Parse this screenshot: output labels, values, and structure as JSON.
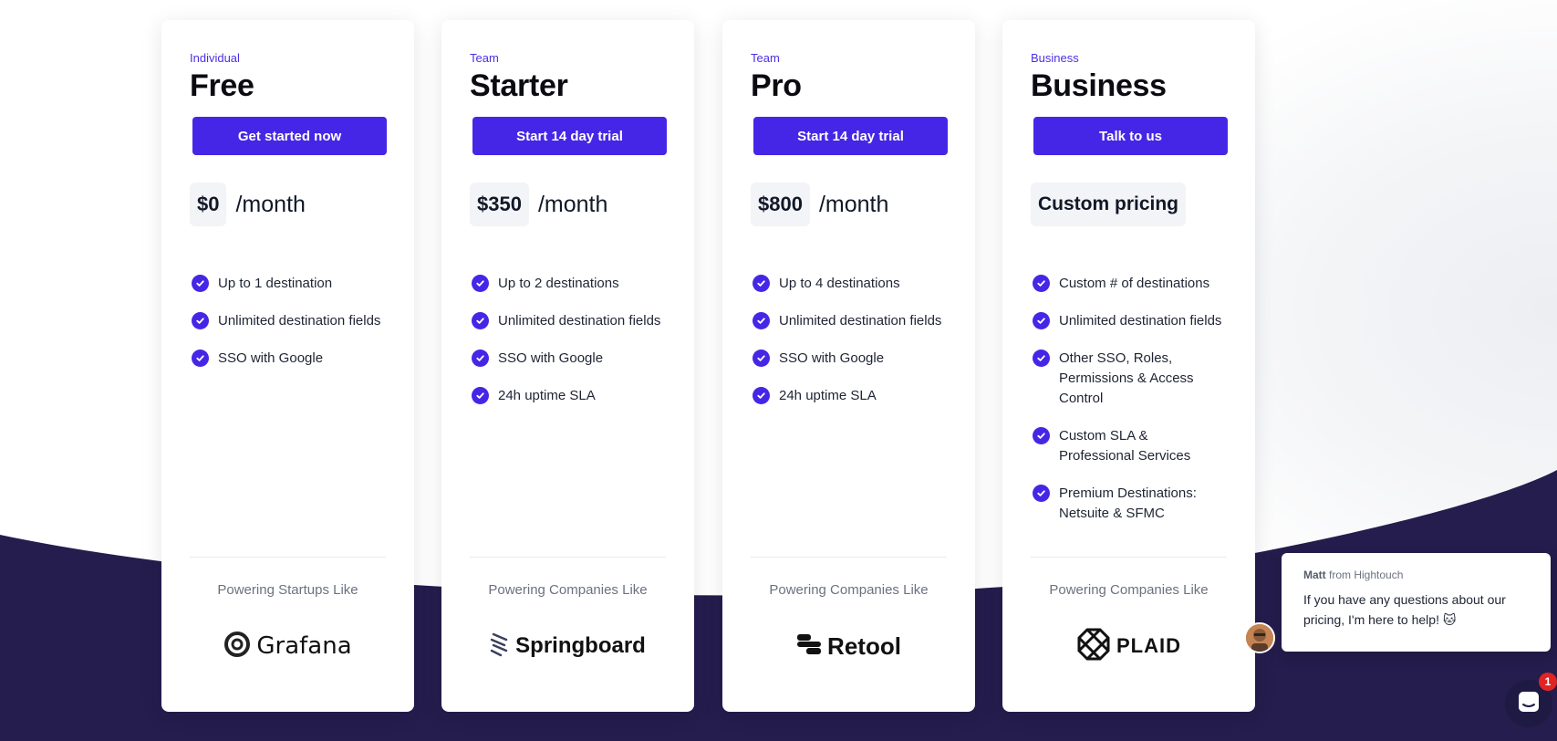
{
  "colors": {
    "accent": "#4626e6",
    "tier_label": "#4f2ee6",
    "dark_navy": "#241d4d",
    "badge_red": "#e02424"
  },
  "plans": [
    {
      "tier": "Individual",
      "name": "Free",
      "cta": "Get started now",
      "price": "$0",
      "period": "/month",
      "features": [
        "Up to 1 destination",
        "Unlimited destination fields",
        "SSO with Google"
      ],
      "powering": "Powering Startups Like",
      "logo": {
        "icon": "grafana-logo-icon",
        "text": "Grafana"
      }
    },
    {
      "tier": "Team",
      "name": "Starter",
      "cta": "Start 14 day trial",
      "price": "$350",
      "period": "/month",
      "features": [
        "Up to 2 destinations",
        "Unlimited destination fields",
        "SSO with Google",
        "24h uptime SLA"
      ],
      "powering": "Powering Companies Like",
      "logo": {
        "icon": "springboard-logo-icon",
        "text": "Springboard"
      }
    },
    {
      "tier": "Team",
      "name": "Pro",
      "cta": "Start 14 day trial",
      "price": "$800",
      "period": "/month",
      "features": [
        "Up to 4 destinations",
        "Unlimited destination fields",
        "SSO with Google",
        "24h uptime SLA"
      ],
      "powering": "Powering Companies Like",
      "logo": {
        "icon": "retool-logo-icon",
        "text": "Retool"
      }
    },
    {
      "tier": "Business",
      "name": "Business",
      "cta": "Talk to us",
      "price": "Custom pricing",
      "period": "",
      "features": [
        "Custom # of destinations",
        "Unlimited destination fields",
        "Other SSO, Roles, Permissions & Access Control",
        "Custom SLA & Professional Services",
        "Premium Destinations: Netsuite & SFMC"
      ],
      "powering": "Powering Companies Like",
      "logo": {
        "icon": "plaid-logo-icon",
        "text": "PLAID"
      }
    }
  ],
  "chat": {
    "sender": "Matt",
    "from_text": "from Hightouch",
    "message": "If you have any questions about our pricing, I'm here to help! 🐱",
    "unread_count": "1",
    "launcher_icon": "chat-launcher-icon"
  }
}
